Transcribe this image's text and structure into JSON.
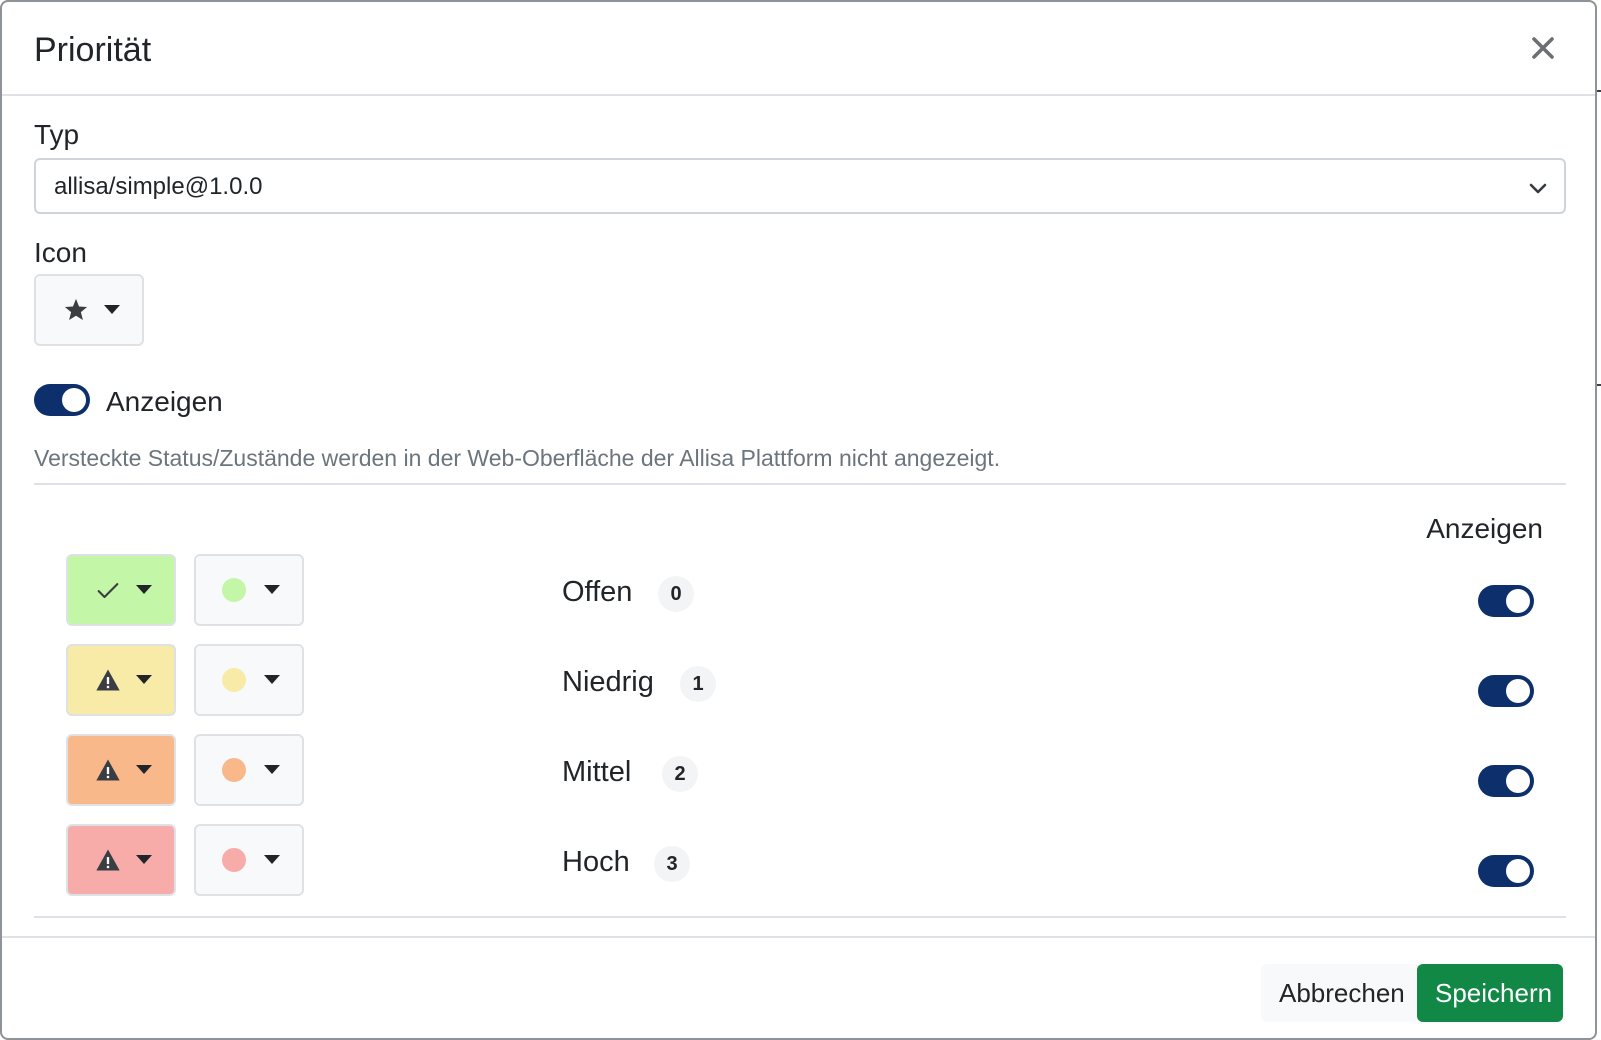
{
  "dialog": {
    "title": "Priorität",
    "close_icon": "close-icon"
  },
  "type_field": {
    "label": "Typ",
    "value": "allisa/simple@1.0.0"
  },
  "icon_field": {
    "label": "Icon",
    "selected_icon": "star-icon"
  },
  "visibility": {
    "label": "Anzeigen",
    "enabled": true,
    "help": "Versteckte Status/Zustände werden in der Web-Oberfläche der Allisa Plattform nicht angezeigt."
  },
  "states_table": {
    "column_header": "Anzeigen",
    "rows": [
      {
        "name": "Offen",
        "value": "0",
        "icon": "check-icon",
        "bg": "#c3f7a7",
        "dot": "#c3f7a7",
        "visible": true
      },
      {
        "name": "Niedrig",
        "value": "1",
        "icon": "warning-icon",
        "bg": "#f8eba7",
        "dot": "#f8eba7",
        "visible": true
      },
      {
        "name": "Mittel",
        "value": "2",
        "icon": "warning-icon",
        "bg": "#f9b88a",
        "dot": "#f9b88a",
        "visible": true
      },
      {
        "name": "Hoch",
        "value": "3",
        "icon": "warning-icon",
        "bg": "#f8acaa",
        "dot": "#f8acaa",
        "visible": true
      }
    ]
  },
  "footer": {
    "cancel_label": "Abbrechen",
    "save_label": "Speichern"
  },
  "colors": {
    "toggle_on": "#0d2f6b",
    "save_button": "#128847"
  }
}
